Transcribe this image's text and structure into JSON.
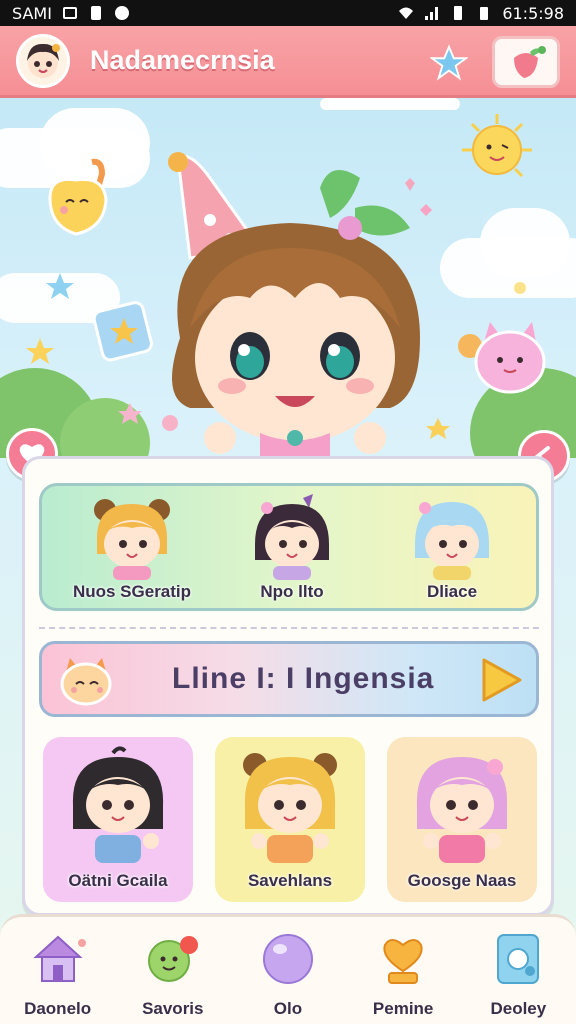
{
  "status_bar": {
    "carrier": "SAMI",
    "time": "61:5:98"
  },
  "header": {
    "title": "Nadamecrnsia",
    "star_icon": "star-icon",
    "shop_icon": "strawberry-icon"
  },
  "friends": [
    {
      "name": "Nuos SGeratip",
      "hair": "#f2b84a"
    },
    {
      "name": "Npo llto",
      "hair": "#3b2b3a"
    },
    {
      "name": "Dliace",
      "hair": "#a9d8f2"
    }
  ],
  "banner": {
    "text": "Lline I: I Ingensia",
    "play_icon": "play-arrow-icon"
  },
  "cards": [
    {
      "name": "Oätni Gcaila",
      "hair": "#2e2a2e",
      "bg": "#f4c8f2"
    },
    {
      "name": "Savehlans",
      "hair": "#f1c14a",
      "bg": "#f8f0a6"
    },
    {
      "name": "Goosge Naas",
      "hair": "#e2a3e0",
      "bg": "#fbe6bf"
    }
  ],
  "nav": [
    {
      "label": "Daonelo",
      "icon": "house-icon"
    },
    {
      "label": "Savoris",
      "icon": "smiley-balloon-icon"
    },
    {
      "label": "Olo",
      "icon": "bubble-icon"
    },
    {
      "label": "Pemine",
      "icon": "heart-trophy-icon"
    },
    {
      "label": "Deoley",
      "icon": "tablet-icon"
    }
  ],
  "colors": {
    "header": "#f58f95",
    "accent_pink": "#f47c94",
    "panel": "#fffdf8"
  }
}
